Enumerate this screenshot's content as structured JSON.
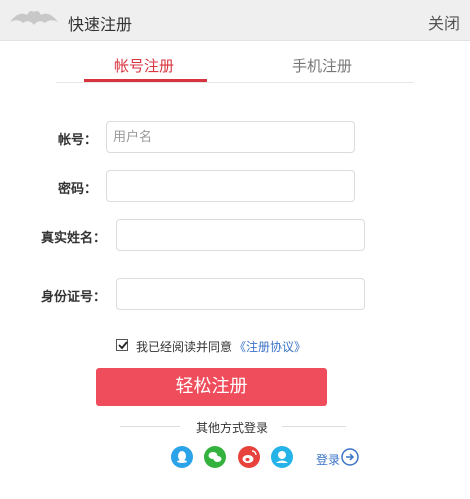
{
  "header": {
    "title": "快速注册",
    "close_label": "关闭"
  },
  "tabs": [
    {
      "label": "帐号注册",
      "active": true
    },
    {
      "label": "手机注册",
      "active": false
    }
  ],
  "form": {
    "account_label": "帐号：",
    "account_placeholder": "用户名",
    "account_value": "",
    "password_label": "密码：",
    "password_value": "",
    "realname_label": "真实姓名：",
    "realname_value": "",
    "idcard_label": "身份证号：",
    "idcard_value": ""
  },
  "agreement": {
    "checked": true,
    "text": "我已经阅读并同意",
    "link": "《注册协议》"
  },
  "submit_label": "轻松注册",
  "other_login": {
    "title": "其他方式登录",
    "icons": [
      "qq-icon",
      "wechat-icon",
      "weibo-icon",
      "qzone-icon"
    ],
    "login_label": "登录"
  },
  "colors": {
    "accent": "#d8343f",
    "button": "#ef4d5b",
    "link": "#3a73c7",
    "qq": "#2aa3e8",
    "wechat": "#33b33e",
    "weibo": "#e8423c",
    "qzone": "#25b3e8"
  }
}
